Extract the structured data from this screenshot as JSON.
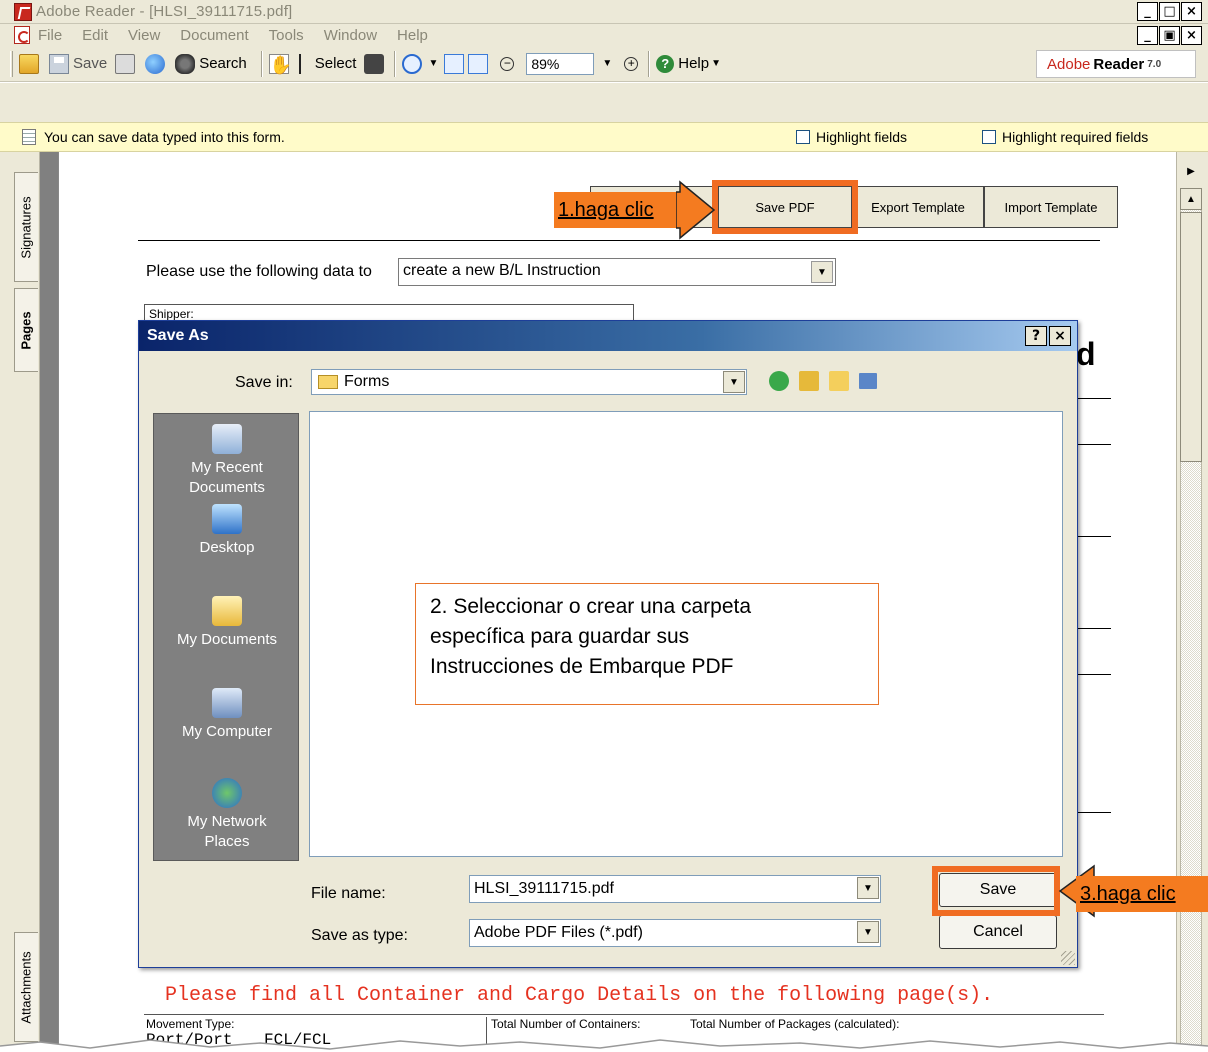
{
  "window": {
    "title": "Adobe Reader - [HLSI_39111715.pdf]",
    "controls": [
      "_",
      "□",
      "×"
    ],
    "doc_controls": [
      "_",
      "▣",
      "×"
    ]
  },
  "menu": {
    "items": [
      "File",
      "Edit",
      "View",
      "Document",
      "Tools",
      "Window",
      "Help"
    ]
  },
  "toolbar": {
    "save_label": "Save",
    "search_label": "Search",
    "select_label": "Select",
    "zoom_value": "89%",
    "help_label": "Help",
    "brand_adobe": "Adobe",
    "brand_reader": "Reader",
    "brand_version": "7.0"
  },
  "infobar": {
    "message": "You can save data typed into this form.",
    "highlight_fields": "Highlight fields",
    "highlight_required": "Highlight required fields"
  },
  "side_tabs": {
    "signatures": "Signatures",
    "pages": "Pages",
    "attachments": "Attachments"
  },
  "document": {
    "buttons": {
      "save_pdf": "Save PDF",
      "export_template": "Export Template",
      "import_template": "Import Template"
    },
    "prompt": "Please use the following data to",
    "select_value": "create a new B/L Instruction",
    "shipper_label": "Shipper:",
    "big_letter": "d",
    "red_notice": "Please find all Container and Cargo Details on the following page(s).",
    "table": {
      "movement_type_label": "Movement Type:",
      "movement_type_value": "Port/Port",
      "fcl_value": "FCL/FCL",
      "total_containers_label": "Total Number of Containers:",
      "total_packages_label": "Total Number of Packages (calculated):"
    }
  },
  "dialog": {
    "title": "Save As",
    "help_btn": "?",
    "close_btn": "×",
    "save_in_label": "Save in:",
    "save_in_value": "Forms",
    "places": [
      {
        "label1": "My Recent",
        "label2": "Documents",
        "icon": "recent-documents-icon"
      },
      {
        "label1": "Desktop",
        "label2": "",
        "icon": "desktop-icon"
      },
      {
        "label1": "My Documents",
        "label2": "",
        "icon": "my-documents-icon"
      },
      {
        "label1": "My Computer",
        "label2": "",
        "icon": "my-computer-icon"
      },
      {
        "label1": "My Network",
        "label2": "Places",
        "icon": "network-places-icon"
      }
    ],
    "file_name_label": "File name:",
    "file_name_value": "HLSI_39111715.pdf",
    "save_as_type_label": "Save as type:",
    "save_as_type_value": "Adobe PDF Files (*.pdf)",
    "save_button": "Save",
    "cancel_button": "Cancel"
  },
  "annotations": {
    "step1": "1.haga clic",
    "step2_line1": "2. Seleccionar o crear una carpeta",
    "step2_line2": "específica para guardar sus",
    "step2_line3": "Instrucciones de Embarque PDF",
    "step3": "3.haga clic",
    "highlight_color": "#f06c22"
  }
}
